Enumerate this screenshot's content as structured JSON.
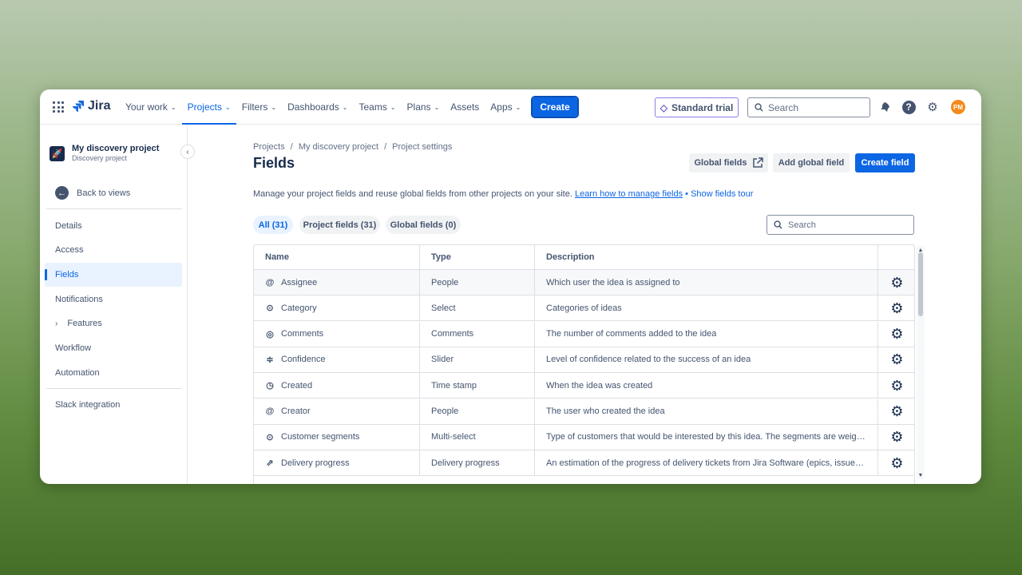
{
  "nav": {
    "logo": "Jira",
    "items": [
      {
        "label": "Your work",
        "chevron": true,
        "active": false
      },
      {
        "label": "Projects",
        "chevron": true,
        "active": true
      },
      {
        "label": "Filters",
        "chevron": true,
        "active": false
      },
      {
        "label": "Dashboards",
        "chevron": true,
        "active": false
      },
      {
        "label": "Teams",
        "chevron": true,
        "active": false
      },
      {
        "label": "Plans",
        "chevron": true,
        "active": false
      },
      {
        "label": "Assets",
        "chevron": false,
        "active": false
      },
      {
        "label": "Apps",
        "chevron": true,
        "active": false
      }
    ],
    "create_label": "Create",
    "trial_label": "Standard trial",
    "search_placeholder": "Search",
    "avatar_initials": "PM"
  },
  "sidebar": {
    "project_name": "My discovery project",
    "project_type": "Discovery project",
    "back_label": "Back to views",
    "items": [
      {
        "label": "Details"
      },
      {
        "label": "Access"
      },
      {
        "label": "Fields"
      },
      {
        "label": "Notifications"
      },
      {
        "label": "Features"
      },
      {
        "label": "Workflow"
      },
      {
        "label": "Automation"
      },
      {
        "label": "Slack integration"
      }
    ]
  },
  "main": {
    "breadcrumb": [
      "Projects",
      "My discovery project",
      "Project settings"
    ],
    "title": "Fields",
    "buttons": {
      "global_fields": "Global fields",
      "add_global_field": "Add global field",
      "create_field": "Create field"
    },
    "description": "Manage your project fields and reuse global fields from other projects on your site.",
    "learn_link": "Learn how to manage fields",
    "tour_link": "Show fields tour",
    "filters": [
      "All (31)",
      "Project fields (31)",
      "Global fields (0)"
    ],
    "table_search_placeholder": "Search",
    "table": {
      "headers": [
        "Name",
        "Type",
        "Description"
      ],
      "rows": [
        {
          "icon": "at-icon",
          "name": "Assignee",
          "type": "People",
          "description": "Which user the idea is assigned to"
        },
        {
          "icon": "select-icon",
          "name": "Category",
          "type": "Select",
          "description": "Categories of ideas"
        },
        {
          "icon": "comment-icon",
          "name": "Comments",
          "type": "Comments",
          "description": "The number of comments added to the idea"
        },
        {
          "icon": "slider-icon",
          "name": "Confidence",
          "type": "Slider",
          "description": "Level of confidence related to the success of an idea"
        },
        {
          "icon": "clock-icon",
          "name": "Created",
          "type": "Time stamp",
          "description": "When the idea was created"
        },
        {
          "icon": "at-icon",
          "name": "Creator",
          "type": "People",
          "description": "The user who created the idea"
        },
        {
          "icon": "select-icon",
          "name": "Customer segments",
          "type": "Multi-select",
          "description": "Type of customers that would be interested by this idea. The segments are weighte..."
        },
        {
          "icon": "delivery-icon",
          "name": "Delivery progress",
          "type": "Delivery progress",
          "description": "An estimation of the progress of delivery tickets from Jira Software (epics, issues) th..."
        }
      ]
    }
  }
}
